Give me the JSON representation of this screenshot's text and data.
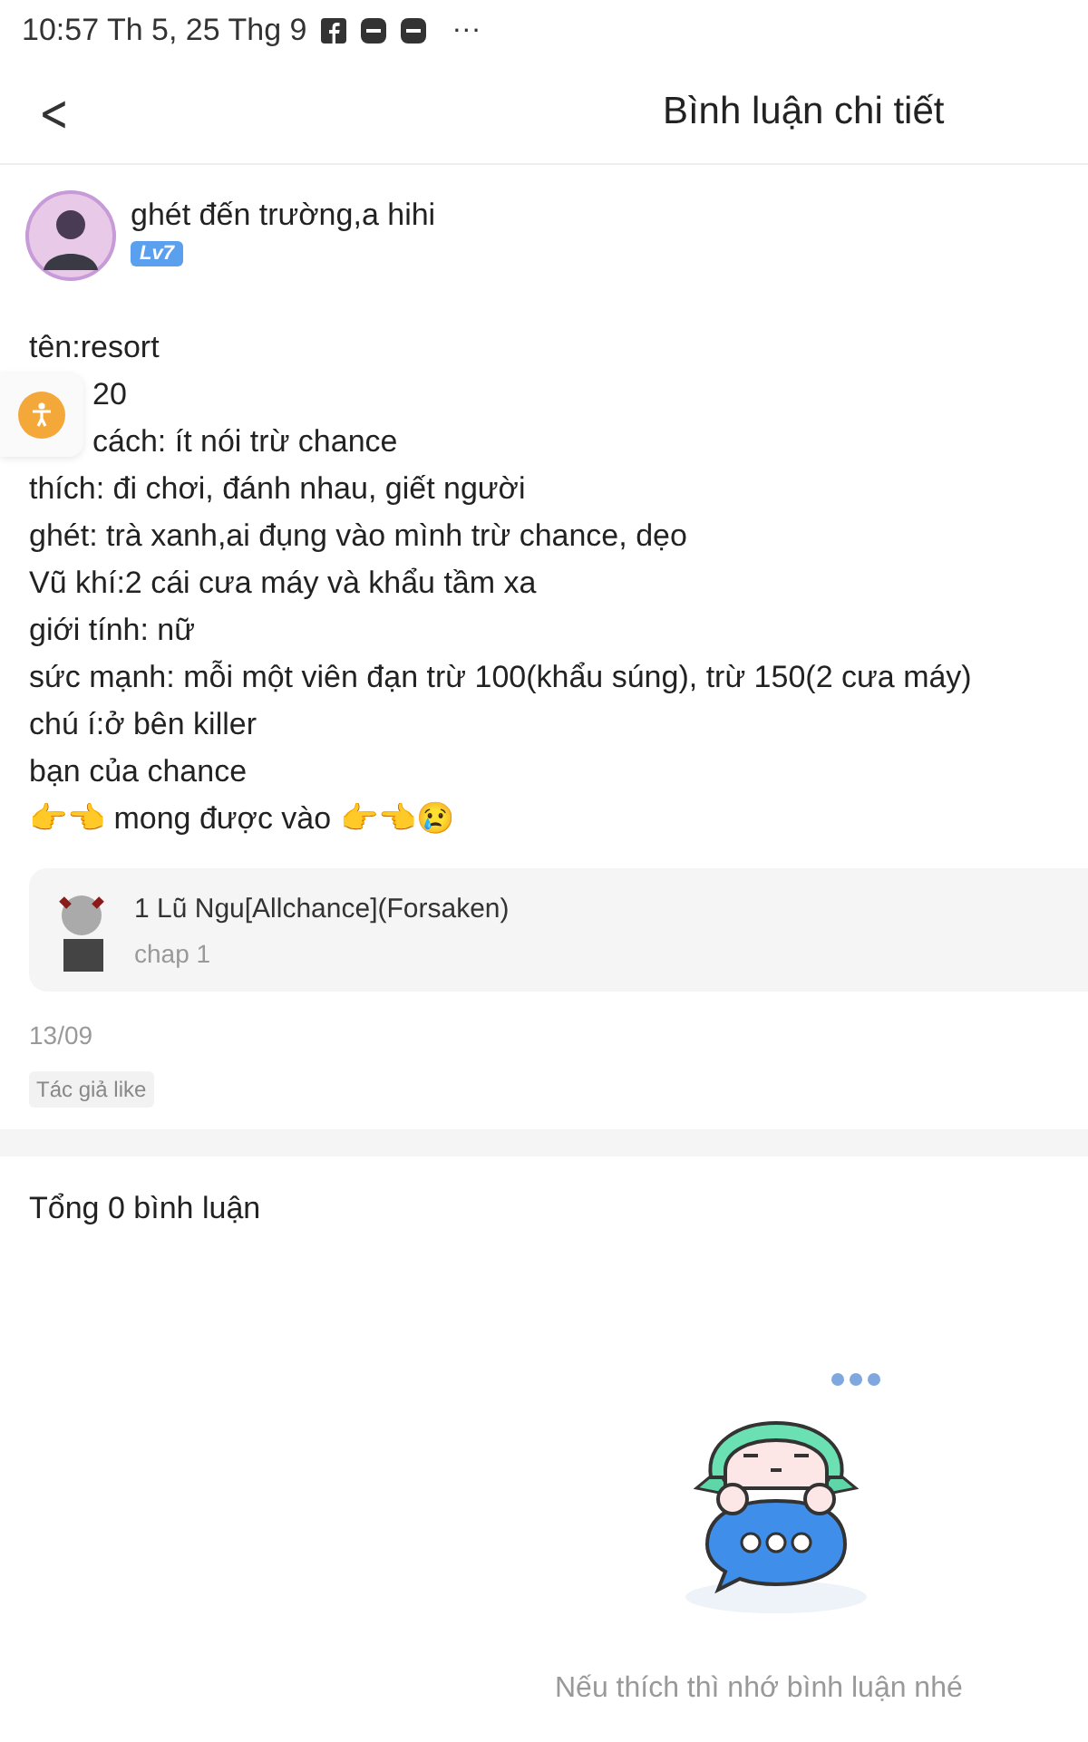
{
  "status_bar": {
    "time": "10:57 Th 5, 25 Thg 9",
    "more": "···"
  },
  "header": {
    "back": "<",
    "title": "Bình luận chi tiết"
  },
  "author": {
    "name": "ghét đến trường,a hihi",
    "level": "Lv7"
  },
  "body_lines": [
    {
      "text": "tên:resort",
      "covered": false
    },
    {
      "text": "20",
      "covered": true
    },
    {
      "text": "cách: ít nói trừ chance",
      "covered": true
    },
    {
      "text": "thích: đi chơi, đánh nhau, giết người",
      "covered": false
    },
    {
      "text": "ghét: trà xanh,ai đụng vào mình trừ chance, dẹo",
      "covered": false
    },
    {
      "text": "Vũ khí:2 cái cưa máy và khẩu tầm xa",
      "covered": false
    },
    {
      "text": "giới tính: nữ",
      "covered": false
    },
    {
      "text": "sức mạnh: mỗi một viên đạn trừ 100(khẩu súng), trừ 150(2 cưa máy)",
      "covered": false
    },
    {
      "text": "chú í:ở bên killer",
      "covered": false
    },
    {
      "text": "bạn của chance",
      "covered": false
    },
    {
      "text": "👉👈 mong được vào 👉👈😢",
      "covered": false
    }
  ],
  "story_card": {
    "title": "1 Lũ Ngu[Allchance](Forsaken)",
    "chapter": "chap 1"
  },
  "date": "13/09",
  "tag": "Tác giả like",
  "comments": {
    "total": "Tổng 0 bình luận",
    "empty_hint": "Nếu thích thì nhớ bình luận nhé"
  }
}
